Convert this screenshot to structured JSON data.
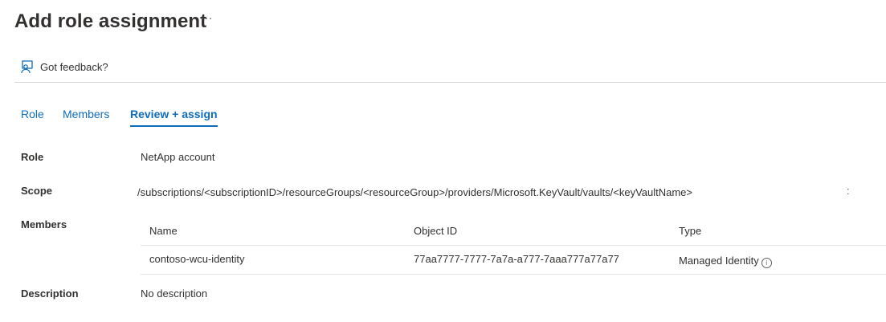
{
  "header": {
    "title": "Add role assignment",
    "more_label": "···"
  },
  "toolbar": {
    "feedback_label": "Got feedback?",
    "feedback_icon": "feedback-person-icon"
  },
  "tabs": [
    {
      "label": "Role",
      "active": false
    },
    {
      "label": "Members",
      "active": false
    },
    {
      "label": "Review + assign",
      "active": true
    }
  ],
  "review": {
    "role_label": "Role",
    "role_value": "NetApp account",
    "scope_label": "Scope",
    "scope_value": "/subscriptions/<subscriptionID>/resourceGroups/<resourceGroup>/providers/Microsoft.KeyVault/vaults/<keyVaultName>",
    "scope_more": ":",
    "members_label": "Members",
    "description_label": "Description",
    "description_value": "No description"
  },
  "members_table": {
    "columns": [
      "Name",
      "Object ID",
      "Type"
    ],
    "rows": [
      {
        "name": "contoso-wcu-identity",
        "object_id": "77aa7777-7777-7a7a-a777-7aaa777a77a77",
        "type": "Managed Identity",
        "type_icon": "info-icon"
      }
    ]
  },
  "colors": {
    "accent": "#0f6cbd",
    "text": "#323130",
    "divider": "#d6d6d6"
  }
}
